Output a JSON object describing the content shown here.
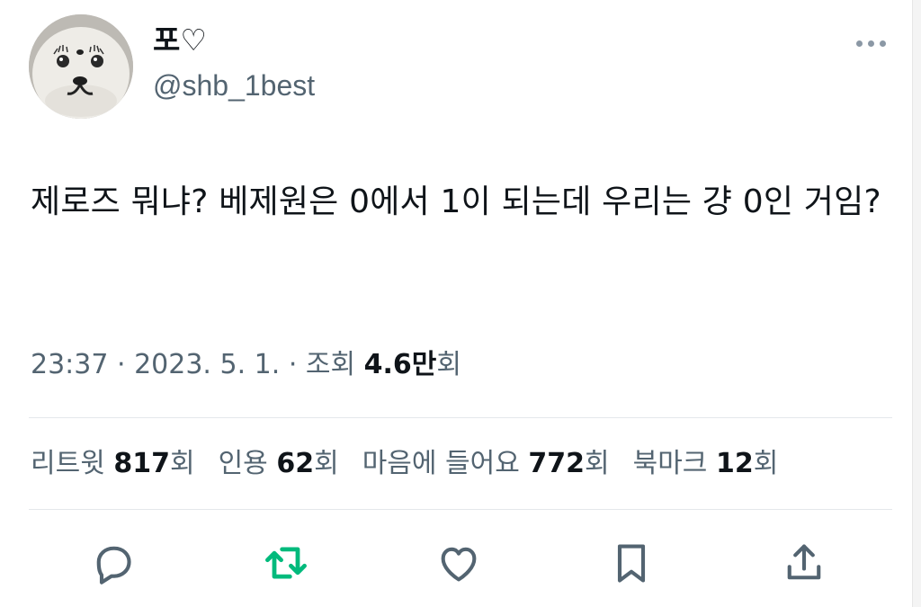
{
  "tweet": {
    "display_name": "포♡",
    "handle": "@shb_1best",
    "text": "제로즈 뭐냐? 베제원은 0에서 1이 되는데 우리는 걍 0인 거임?",
    "time": "23:37",
    "separator": " · ",
    "date": "2023. 5. 1.",
    "views_prefix": "조회 ",
    "views_value": "4.6",
    "views_unit_bold": "만",
    "views_suffix": "회"
  },
  "stats": [
    {
      "label": "리트윗 ",
      "value": "817",
      "suffix": "회"
    },
    {
      "label": "인용 ",
      "value": "62",
      "suffix": "회"
    },
    {
      "label": "마음에 들어요 ",
      "value": "772",
      "suffix": "회"
    },
    {
      "label": "북마크 ",
      "value": "12",
      "suffix": "회"
    }
  ],
  "actions": [
    {
      "icon": "reply-icon",
      "color": "#536471"
    },
    {
      "icon": "retweet-icon",
      "color": "#00ba7c"
    },
    {
      "icon": "like-icon",
      "color": "#536471"
    },
    {
      "icon": "bookmark-icon",
      "color": "#536471"
    },
    {
      "icon": "share-icon",
      "color": "#536471"
    }
  ],
  "colors": {
    "text_primary": "#0f1419",
    "text_secondary": "#536471",
    "retweet_active": "#00ba7c",
    "divider": "#e4e8eb"
  }
}
